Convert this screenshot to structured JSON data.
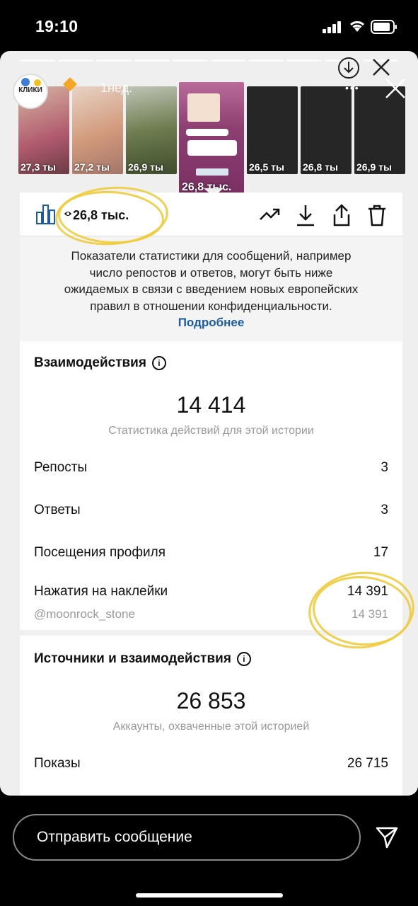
{
  "status": {
    "time": "19:10"
  },
  "story": {
    "avatar_label": "КЛИКИ",
    "time_ago": "1нед.",
    "thumbnails": [
      {
        "views": "27,3 ты",
        "color": "#c98f7a"
      },
      {
        "views": "27,2 ты",
        "color": "#d6b8a6"
      },
      {
        "views": "26,9 ты",
        "color": "#7d8a5a"
      },
      {
        "views": "26,8 тыс.",
        "color": "#8d3f72",
        "selected": true
      },
      {
        "views": "26,5 ты",
        "color": "#262626"
      },
      {
        "views": "26,8 ты",
        "color": "#262626"
      },
      {
        "views": "26,9 ты",
        "color": "#262626"
      }
    ]
  },
  "toolbar": {
    "view_count": "26,8 тыс.",
    "icons": [
      "bar-chart-icon",
      "eye-icon",
      "promote-trend-icon",
      "download-icon",
      "share-icon",
      "trash-icon"
    ]
  },
  "notice": {
    "lines": [
      "Показатели статистики для сообщений, например",
      "число репостов и ответов, могут быть ниже",
      "ожидаемых в связи с введением новых европейских",
      "правил в отношении конфиденциальности."
    ],
    "link": "Подробнее"
  },
  "interactions": {
    "title": "Взаимодействия",
    "total": "14 414",
    "subtitle": "Статистика действий для этой истории",
    "rows": [
      {
        "label": "Репосты",
        "value": "3"
      },
      {
        "label": "Ответы",
        "value": "3"
      },
      {
        "label": "Посещения профиля",
        "value": "17"
      },
      {
        "label": "Нажатия на наклейки",
        "value": "14 391"
      }
    ],
    "sticker": {
      "label": "@moonrock_stone",
      "value": "14 391"
    }
  },
  "reach": {
    "title": "Источники и взаимодействия",
    "total": "26 853",
    "subtitle": "Аккаунты, охваченные этой историей",
    "rows": [
      {
        "label": "Показы",
        "value": "26 715"
      }
    ]
  },
  "bottom": {
    "message_placeholder": "Отправить сообщение"
  },
  "colors": {
    "highlight": "#f0cb3a",
    "link": "#1a5aa6"
  }
}
